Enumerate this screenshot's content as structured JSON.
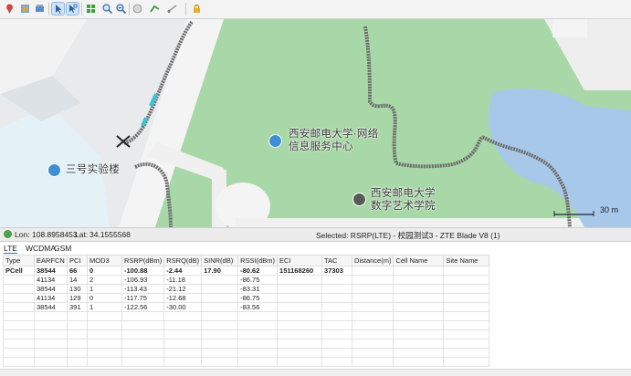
{
  "map": {
    "labels": {
      "lab_building": "三号实验楼",
      "network_center_line1": "西安邮电大学·网络",
      "network_center_line2": "信息服务中心",
      "art_school_line1": "西安邮电大学",
      "art_school_line2": "数字艺术学院"
    },
    "scale_label": "30 m"
  },
  "statusbar": {
    "lon_label": "Lon:",
    "lon_value": "108.8958453",
    "lat_label": "Lat:",
    "lat_value": "34.1555568",
    "selected": "Selected: RSRP(LTE) - 校园测试3 - ZTE Blade V8 (1)"
  },
  "tabs": [
    "LTE",
    "WCDMA",
    "GSM"
  ],
  "table": {
    "columns": [
      "Type",
      "EARFCN",
      "PCI",
      "MOD3",
      "RSRP(dBm)",
      "RSRQ(dB)",
      "SINR(dB)",
      "RSSI(dBm)",
      "ECI",
      "TAC",
      "Distance(m)",
      "Cell Name",
      "Site Name"
    ],
    "rows": [
      [
        "PCell",
        "38544",
        "66",
        "0",
        "-100.88",
        "-2.44",
        "17.90",
        "-80.62",
        "151168260",
        "37303",
        "",
        "",
        ""
      ],
      [
        "",
        "41134",
        "14",
        "2",
        "-106.93",
        "-11.18",
        "",
        "-86.75",
        "",
        "",
        "",
        "",
        ""
      ],
      [
        "",
        "38544",
        "130",
        "1",
        "-113.43",
        "-21.12",
        "",
        "-83.31",
        "",
        "",
        "",
        "",
        ""
      ],
      [
        "",
        "41134",
        "129",
        "0",
        "-117.75",
        "-12.68",
        "",
        "-86.75",
        "",
        "",
        "",
        "",
        ""
      ],
      [
        "",
        "38544",
        "391",
        "1",
        "-122.56",
        "-30.00",
        "",
        "-83.56",
        "",
        "",
        "",
        "",
        ""
      ]
    ]
  },
  "colors": {
    "park": "#a8d8a8",
    "water": "#a7c8e8",
    "road": "#f2f2f2",
    "track": "#6b6b6b",
    "track_highlight": "#35c4d8",
    "poi_icon": "#3e8fd3"
  },
  "toolbar_icons": [
    "pin-icon",
    "layers-icon",
    "stack-icon",
    "pointer-icon",
    "select-area-icon",
    "grid-icon",
    "zoom-in-icon",
    "zoom-out-icon",
    "globe-icon",
    "route-icon",
    "measure-icon",
    "lock-icon"
  ]
}
